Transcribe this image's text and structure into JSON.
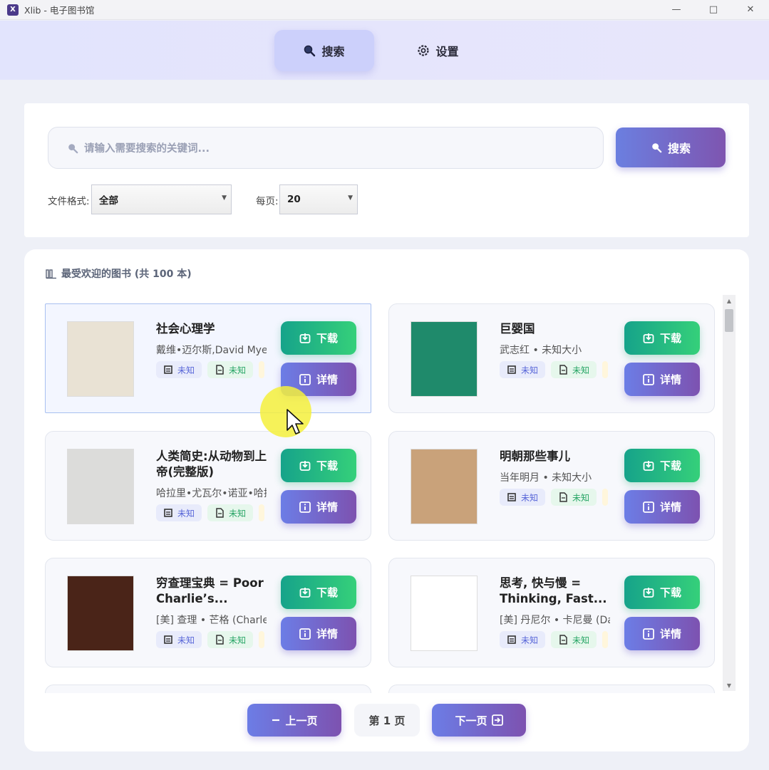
{
  "window": {
    "title": "Xlib - 电子图书馆",
    "icon_letter": "X",
    "controls": [
      "minimize-icon",
      "maximize-icon",
      "close-icon"
    ]
  },
  "nav": {
    "tabs": [
      {
        "label": "搜索",
        "icon": "search-icon",
        "active": true
      },
      {
        "label": "设置",
        "icon": "gear-icon",
        "active": false
      }
    ]
  },
  "search": {
    "placeholder": "请输入需要搜索的关键词...",
    "button_label": "搜索",
    "format_label": "文件格式:",
    "format_value": "全部",
    "per_page_label": "每页:",
    "per_page_value": "20"
  },
  "results": {
    "heading": "最受欢迎的图书 (共 100 本)",
    "download_label": "下载",
    "details_label": "详情",
    "books": [
      {
        "title": "社会心理学",
        "meta": "戴维•迈尔斯,David Myers",
        "badge1": "未知",
        "badge2": "未知",
        "cover_color": "#e9e2d4"
      },
      {
        "title": "巨婴国",
        "meta": "武志红 • 未知大小",
        "badge1": "未知",
        "badge2": "未知",
        "cover_color": "#1f8a6b"
      },
      {
        "title": "人类简史:从动物到上帝(完整版)",
        "meta": "哈拉里•尤瓦尔•诺亚•哈拉里",
        "badge1": "未知",
        "badge2": "未知",
        "cover_color": "#dcdcda"
      },
      {
        "title": "明朝那些事儿",
        "meta": "当年明月 • 未知大小",
        "badge1": "未知",
        "badge2": "未知",
        "cover_color": "#c9a27a"
      },
      {
        "title": "穷查理宝典 = Poor Charlie’s...",
        "meta": "[美] 查理 • 芒格 (Charles)",
        "badge1": "未知",
        "badge2": "未知",
        "cover_color": "#4a2418"
      },
      {
        "title": "思考, 快与慢 = Thinking, Fast...",
        "meta": "[美] 丹尼尔 • 卡尼曼 (Daniel)",
        "badge1": "未知",
        "badge2": "未知",
        "cover_color": "#ffffff"
      }
    ]
  },
  "pagination": {
    "prev_label": "上一页",
    "page_label": "第 1 页",
    "next_label": "下一页"
  }
}
